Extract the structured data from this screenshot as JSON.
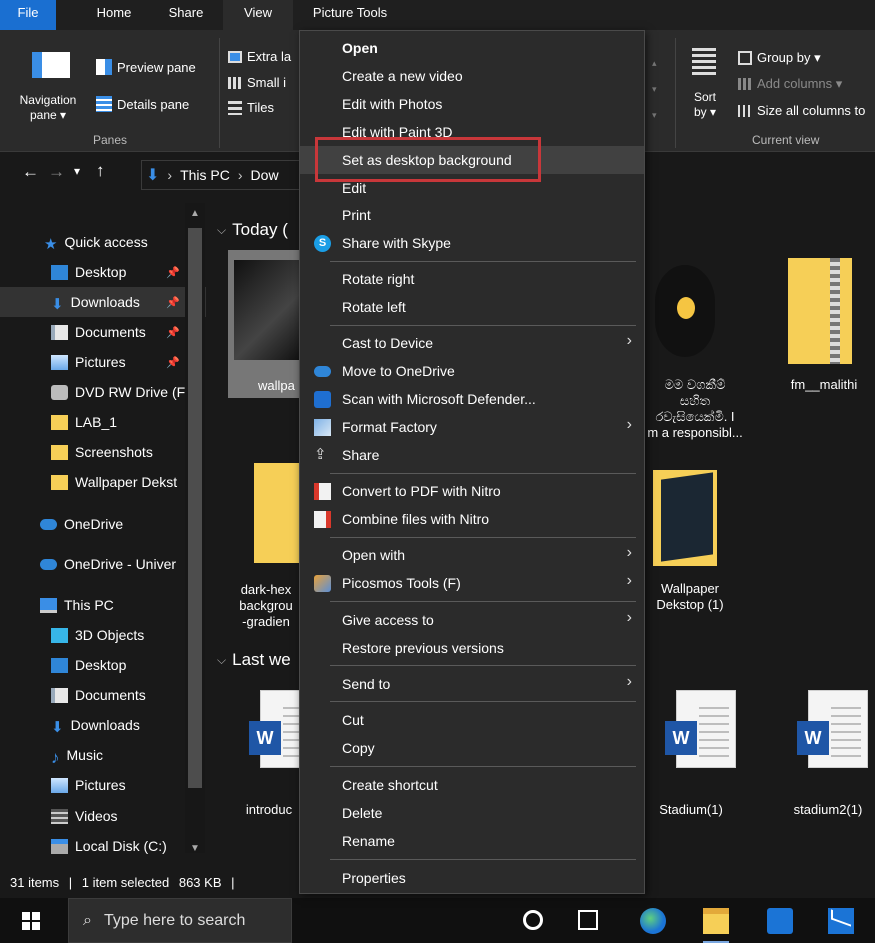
{
  "ribbon_tabs": [
    "File",
    "Home",
    "Share",
    "View",
    "Picture Tools"
  ],
  "ribbon": {
    "navigation_pane_line1": "Navigation",
    "navigation_pane_line2": "pane ▾",
    "preview_pane": "Preview pane",
    "details_pane": "Details pane",
    "panes_label": "Panes",
    "extra_large": "Extra la",
    "small_icons": "Small i",
    "tiles": "Tiles",
    "sort_by_line1": "Sort",
    "sort_by_line2": "by ▾",
    "group_by": "Group by ▾",
    "add_columns": "Add columns ▾",
    "size_columns": "Size all columns to",
    "current_view_label": "Current view"
  },
  "address": {
    "crumb_this_pc": "This PC",
    "crumb_downloads": "Dow"
  },
  "nav_pane": {
    "items": [
      {
        "label": "Quick access",
        "icon": "star-icon"
      },
      {
        "label": "Desktop",
        "icon": "desktop-folder-icon",
        "pinned": true
      },
      {
        "label": "Downloads",
        "icon": "download-arrow-icon",
        "pinned": true
      },
      {
        "label": "Documents",
        "icon": "documents-icon",
        "pinned": true
      },
      {
        "label": "Pictures",
        "icon": "pictures-icon",
        "pinned": true
      },
      {
        "label": "DVD RW Drive (F",
        "icon": "dvd-drive-icon"
      },
      {
        "label": "LAB_1",
        "icon": "folder-icon"
      },
      {
        "label": "Screenshots",
        "icon": "folder-icon"
      },
      {
        "label": "Wallpaper Dekst",
        "icon": "folder-icon"
      },
      {
        "label": "OneDrive",
        "icon": "cloud-icon"
      },
      {
        "label": "OneDrive - Univer",
        "icon": "cloud-icon"
      },
      {
        "label": "This PC",
        "icon": "computer-icon"
      },
      {
        "label": "3D Objects",
        "icon": "3d-objects-icon"
      },
      {
        "label": "Desktop",
        "icon": "desktop-folder-icon"
      },
      {
        "label": "Documents",
        "icon": "documents-icon"
      },
      {
        "label": "Downloads",
        "icon": "download-arrow-icon"
      },
      {
        "label": "Music",
        "icon": "music-note-icon"
      },
      {
        "label": "Pictures",
        "icon": "pictures-icon"
      },
      {
        "label": "Videos",
        "icon": "videos-icon"
      },
      {
        "label": "Local Disk (C:)",
        "icon": "disk-icon"
      }
    ]
  },
  "content": {
    "group_today": "Today (",
    "group_last_week": "Last we",
    "files": {
      "wallpaper": "wallpa",
      "lightbulb_line1": "මම වගකීම්",
      "lightbulb_line2": "සහිත",
      "lightbulb_line3": "රවැසියෙක්මි. I",
      "lightbulb_line4": "m a responsibl...",
      "fm_malithi": "fm__malithi",
      "dark_hex_line1": "dark-hex",
      "dark_hex_line2": "backgrou",
      "dark_hex_line3": "-gradien",
      "wallpaper_folder_line1": "Wallpaper",
      "wallpaper_folder_line2": "Dekstop (1)",
      "introduc": "introduc",
      "stadium1": "Stadium(1)",
      "stadium2": "stadium2(1)"
    }
  },
  "context_menu": {
    "items": [
      {
        "label": "Open",
        "bold": true
      },
      {
        "label": "Create a new video"
      },
      {
        "label": "Edit with Photos"
      },
      {
        "label": "Edit with Paint 3D"
      },
      {
        "label": "Set as desktop background",
        "hovered": true
      },
      {
        "label": "Edit"
      },
      {
        "label": "Print"
      },
      {
        "label": "Share with Skype",
        "icon": "skype-icon"
      },
      {
        "label": "Rotate right"
      },
      {
        "label": "Rotate left"
      },
      {
        "label": "Cast to Device",
        "submenu": true
      },
      {
        "label": "Move to OneDrive",
        "icon": "onedrive-cloud-icon"
      },
      {
        "label": "Scan with Microsoft Defender...",
        "icon": "defender-shield-icon"
      },
      {
        "label": "Format Factory",
        "icon": "format-factory-icon",
        "submenu": true
      },
      {
        "label": "Share",
        "icon": "share-icon"
      },
      {
        "label": "Convert to PDF with Nitro",
        "icon": "nitro-pdf-icon"
      },
      {
        "label": "Combine files with Nitro",
        "icon": "nitro-combine-icon"
      },
      {
        "label": "Open with",
        "submenu": true
      },
      {
        "label": "Picosmos Tools (F)",
        "icon": "picosmos-icon",
        "submenu": true
      },
      {
        "label": "Give access to",
        "submenu": true
      },
      {
        "label": "Restore previous versions"
      },
      {
        "label": "Send to",
        "submenu": true
      },
      {
        "label": "Cut"
      },
      {
        "label": "Copy"
      },
      {
        "label": "Create shortcut"
      },
      {
        "label": "Delete"
      },
      {
        "label": "Rename"
      },
      {
        "label": "Properties"
      }
    ]
  },
  "status_bar": {
    "items_count": "31 items",
    "sep1": "|",
    "selected": "1 item selected",
    "size": "863 KB",
    "sep2": "|"
  },
  "taskbar": {
    "search_placeholder": "Type here to search"
  },
  "colors": {
    "accent": "#1a6fd1",
    "highlight_box": "#c8373a",
    "folder_yellow": "#f6cf57",
    "word_blue": "#1f56a6"
  }
}
